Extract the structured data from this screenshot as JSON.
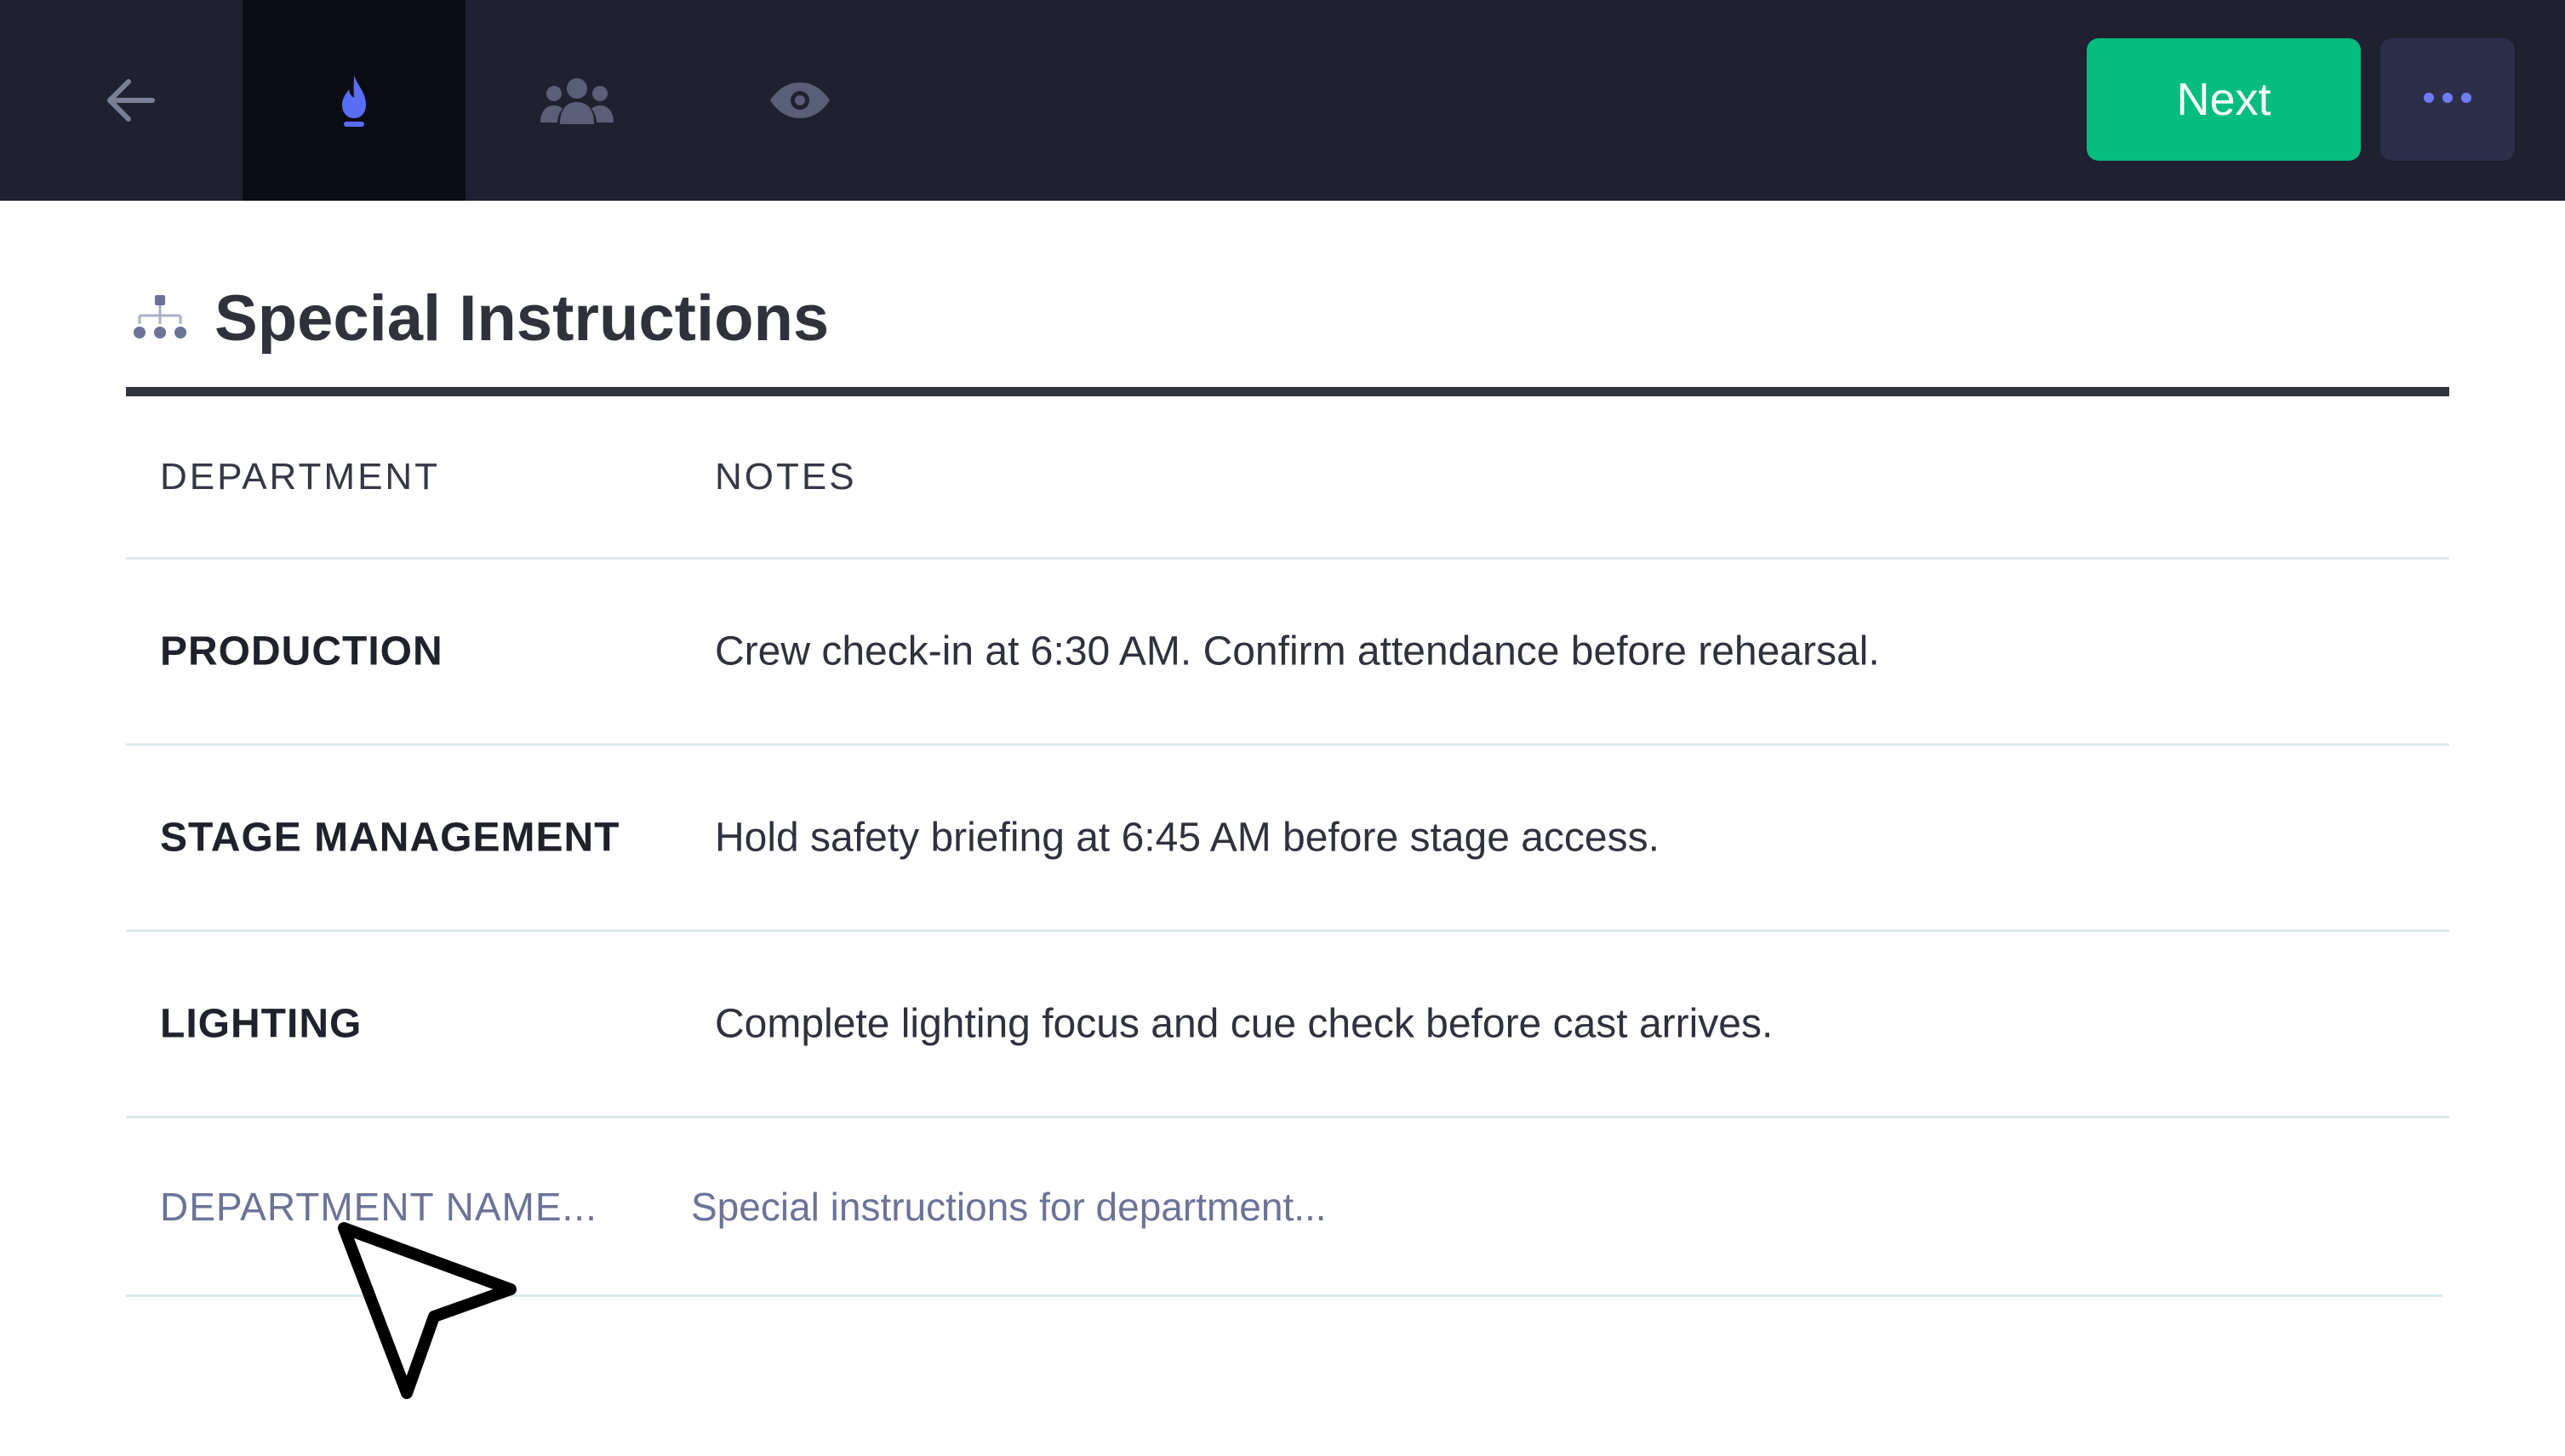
{
  "toolbar": {
    "back_icon": "arrow-left-icon",
    "tabs": [
      {
        "icon": "flame-icon",
        "active": true
      },
      {
        "icon": "users-icon",
        "active": false
      },
      {
        "icon": "eye-icon",
        "active": false
      }
    ],
    "next_label": "Next",
    "more_icon": "ellipsis-icon"
  },
  "section": {
    "icon": "sitemap-icon",
    "title": "Special Instructions"
  },
  "table": {
    "headers": {
      "department": "DEPARTMENT",
      "notes": "NOTES"
    },
    "rows": [
      {
        "department": "PRODUCTION",
        "notes": "Crew check-in at 6:30 AM. Confirm attendance before rehearsal."
      },
      {
        "department": "STAGE MANAGEMENT",
        "notes": "Hold safety briefing at 6:45 AM before stage access."
      },
      {
        "department": "LIGHTING",
        "notes": "Complete lighting focus and cue check before cast arrives."
      }
    ],
    "new_row": {
      "department_placeholder": "DEPARTMENT NAME...",
      "notes_placeholder": "Special instructions for department..."
    }
  },
  "colors": {
    "topbar_bg": "#1f2130",
    "active_tab_bg": "#0c0c13",
    "accent_blue": "#5b6cf5",
    "next_green": "#05bd7e",
    "more_bg": "#2c2f4a",
    "muted_icon": "#5b5e76"
  }
}
